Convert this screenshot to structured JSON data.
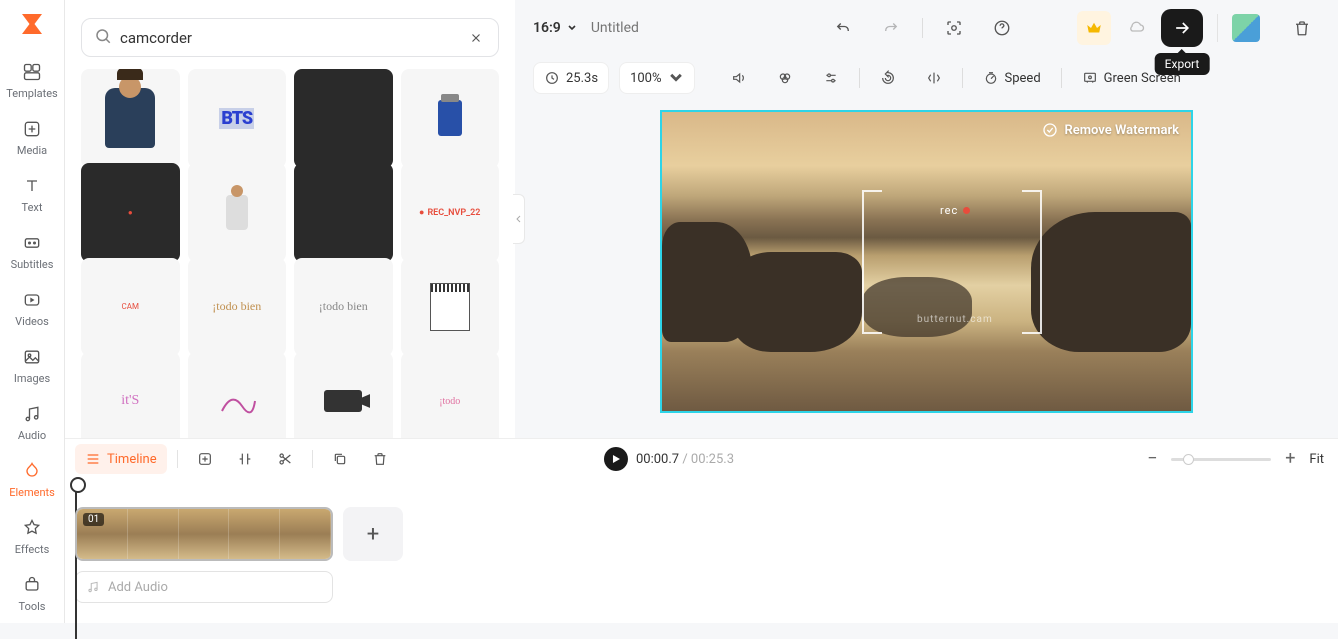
{
  "sidebar": {
    "items": [
      {
        "label": "Templates"
      },
      {
        "label": "Media"
      },
      {
        "label": "Text"
      },
      {
        "label": "Subtitles"
      },
      {
        "label": "Videos"
      },
      {
        "label": "Images"
      },
      {
        "label": "Audio"
      },
      {
        "label": "Elements"
      },
      {
        "label": "Effects"
      },
      {
        "label": "Tools"
      }
    ]
  },
  "search": {
    "value": "camcorder"
  },
  "elements": [
    {
      "type": "person"
    },
    {
      "type": "bts",
      "text": "BTS"
    },
    {
      "type": "blank-dark"
    },
    {
      "type": "lighter"
    },
    {
      "type": "rec-dot-dark"
    },
    {
      "type": "person2"
    },
    {
      "type": "blank-dark2"
    },
    {
      "type": "rec",
      "text": "REC_NVP_22"
    },
    {
      "type": "cam",
      "text": "CAM"
    },
    {
      "type": "todo",
      "text": "¡todo bien"
    },
    {
      "type": "todo2",
      "text": "¡todo bien"
    },
    {
      "type": "notebook"
    },
    {
      "type": "its",
      "text": "it'S"
    },
    {
      "type": "squiggle"
    },
    {
      "type": "camcorder"
    },
    {
      "type": "pink",
      "text": "¡todo"
    }
  ],
  "header": {
    "aspect": "16:9",
    "title_placeholder": "Untitled",
    "export_tooltip": "Export"
  },
  "preview_toolbar": {
    "duration": "25.3s",
    "zoom": "100%",
    "speed": "Speed",
    "green_screen": "Green Screen"
  },
  "canvas": {
    "rec_label": "rec",
    "subtext": "butternut.cam",
    "remove_watermark": "Remove Watermark"
  },
  "timeline": {
    "tab": "Timeline",
    "current": "00:00.7",
    "duration": "00:25.3",
    "clip_badge": "01",
    "add_audio": "Add Audio",
    "fit": "Fit"
  }
}
